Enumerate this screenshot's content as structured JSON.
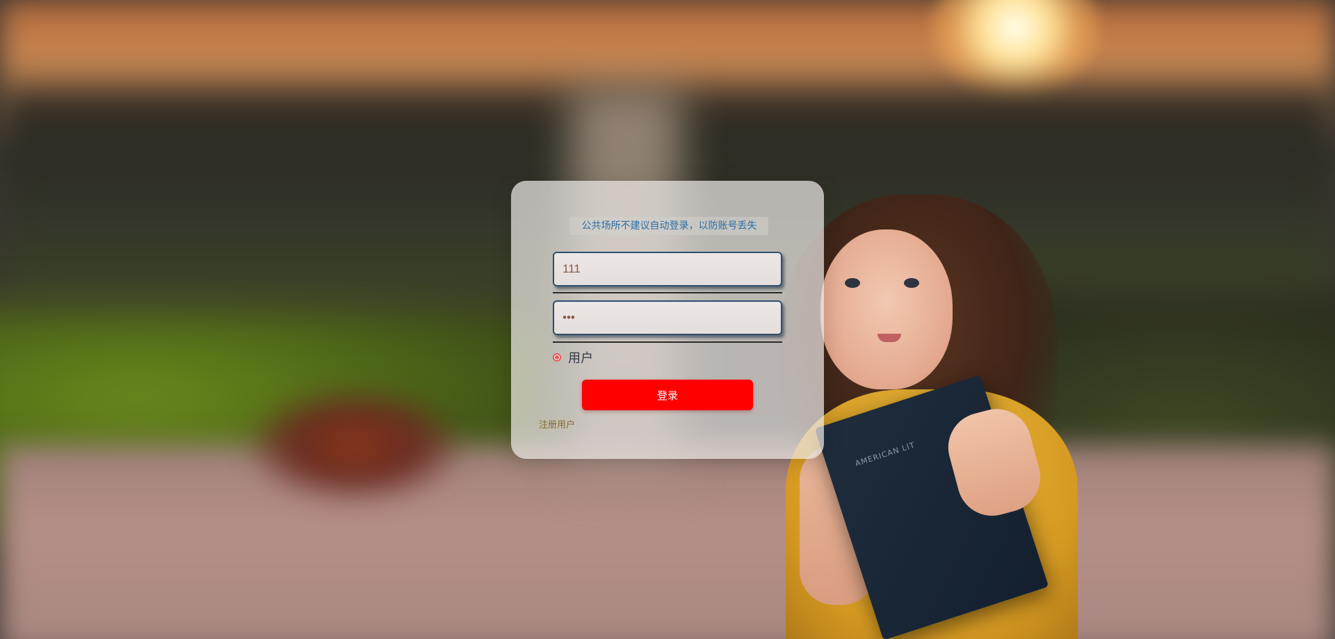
{
  "login": {
    "notice": "公共场所不建议自动登录，以防账号丢失",
    "username_value": "111",
    "password_value": "•••",
    "role_label": "用户",
    "submit_label": "登录",
    "register_label": "注册用户"
  },
  "background": {
    "book_text": "AMERICAN LIT"
  },
  "colors": {
    "accent": "#ff0000",
    "notice_text": "#2b6ea8",
    "register_text": "#8a6a2a"
  }
}
